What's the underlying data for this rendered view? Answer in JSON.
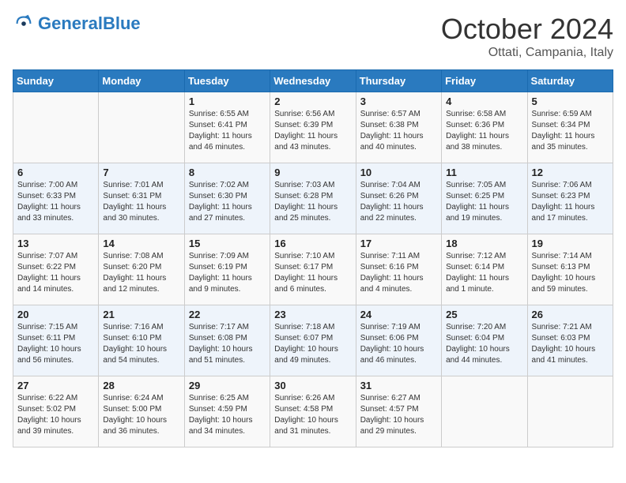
{
  "header": {
    "logo_general": "General",
    "logo_blue": "Blue",
    "month_title": "October 2024",
    "location": "Ottati, Campania, Italy"
  },
  "days_of_week": [
    "Sunday",
    "Monday",
    "Tuesday",
    "Wednesday",
    "Thursday",
    "Friday",
    "Saturday"
  ],
  "weeks": [
    [
      {
        "day": "",
        "info": ""
      },
      {
        "day": "",
        "info": ""
      },
      {
        "day": "1",
        "info": "Sunrise: 6:55 AM\nSunset: 6:41 PM\nDaylight: 11 hours and 46 minutes."
      },
      {
        "day": "2",
        "info": "Sunrise: 6:56 AM\nSunset: 6:39 PM\nDaylight: 11 hours and 43 minutes."
      },
      {
        "day": "3",
        "info": "Sunrise: 6:57 AM\nSunset: 6:38 PM\nDaylight: 11 hours and 40 minutes."
      },
      {
        "day": "4",
        "info": "Sunrise: 6:58 AM\nSunset: 6:36 PM\nDaylight: 11 hours and 38 minutes."
      },
      {
        "day": "5",
        "info": "Sunrise: 6:59 AM\nSunset: 6:34 PM\nDaylight: 11 hours and 35 minutes."
      }
    ],
    [
      {
        "day": "6",
        "info": "Sunrise: 7:00 AM\nSunset: 6:33 PM\nDaylight: 11 hours and 33 minutes."
      },
      {
        "day": "7",
        "info": "Sunrise: 7:01 AM\nSunset: 6:31 PM\nDaylight: 11 hours and 30 minutes."
      },
      {
        "day": "8",
        "info": "Sunrise: 7:02 AM\nSunset: 6:30 PM\nDaylight: 11 hours and 27 minutes."
      },
      {
        "day": "9",
        "info": "Sunrise: 7:03 AM\nSunset: 6:28 PM\nDaylight: 11 hours and 25 minutes."
      },
      {
        "day": "10",
        "info": "Sunrise: 7:04 AM\nSunset: 6:26 PM\nDaylight: 11 hours and 22 minutes."
      },
      {
        "day": "11",
        "info": "Sunrise: 7:05 AM\nSunset: 6:25 PM\nDaylight: 11 hours and 19 minutes."
      },
      {
        "day": "12",
        "info": "Sunrise: 7:06 AM\nSunset: 6:23 PM\nDaylight: 11 hours and 17 minutes."
      }
    ],
    [
      {
        "day": "13",
        "info": "Sunrise: 7:07 AM\nSunset: 6:22 PM\nDaylight: 11 hours and 14 minutes."
      },
      {
        "day": "14",
        "info": "Sunrise: 7:08 AM\nSunset: 6:20 PM\nDaylight: 11 hours and 12 minutes."
      },
      {
        "day": "15",
        "info": "Sunrise: 7:09 AM\nSunset: 6:19 PM\nDaylight: 11 hours and 9 minutes."
      },
      {
        "day": "16",
        "info": "Sunrise: 7:10 AM\nSunset: 6:17 PM\nDaylight: 11 hours and 6 minutes."
      },
      {
        "day": "17",
        "info": "Sunrise: 7:11 AM\nSunset: 6:16 PM\nDaylight: 11 hours and 4 minutes."
      },
      {
        "day": "18",
        "info": "Sunrise: 7:12 AM\nSunset: 6:14 PM\nDaylight: 11 hours and 1 minute."
      },
      {
        "day": "19",
        "info": "Sunrise: 7:14 AM\nSunset: 6:13 PM\nDaylight: 10 hours and 59 minutes."
      }
    ],
    [
      {
        "day": "20",
        "info": "Sunrise: 7:15 AM\nSunset: 6:11 PM\nDaylight: 10 hours and 56 minutes."
      },
      {
        "day": "21",
        "info": "Sunrise: 7:16 AM\nSunset: 6:10 PM\nDaylight: 10 hours and 54 minutes."
      },
      {
        "day": "22",
        "info": "Sunrise: 7:17 AM\nSunset: 6:08 PM\nDaylight: 10 hours and 51 minutes."
      },
      {
        "day": "23",
        "info": "Sunrise: 7:18 AM\nSunset: 6:07 PM\nDaylight: 10 hours and 49 minutes."
      },
      {
        "day": "24",
        "info": "Sunrise: 7:19 AM\nSunset: 6:06 PM\nDaylight: 10 hours and 46 minutes."
      },
      {
        "day": "25",
        "info": "Sunrise: 7:20 AM\nSunset: 6:04 PM\nDaylight: 10 hours and 44 minutes."
      },
      {
        "day": "26",
        "info": "Sunrise: 7:21 AM\nSunset: 6:03 PM\nDaylight: 10 hours and 41 minutes."
      }
    ],
    [
      {
        "day": "27",
        "info": "Sunrise: 6:22 AM\nSunset: 5:02 PM\nDaylight: 10 hours and 39 minutes."
      },
      {
        "day": "28",
        "info": "Sunrise: 6:24 AM\nSunset: 5:00 PM\nDaylight: 10 hours and 36 minutes."
      },
      {
        "day": "29",
        "info": "Sunrise: 6:25 AM\nSunset: 4:59 PM\nDaylight: 10 hours and 34 minutes."
      },
      {
        "day": "30",
        "info": "Sunrise: 6:26 AM\nSunset: 4:58 PM\nDaylight: 10 hours and 31 minutes."
      },
      {
        "day": "31",
        "info": "Sunrise: 6:27 AM\nSunset: 4:57 PM\nDaylight: 10 hours and 29 minutes."
      },
      {
        "day": "",
        "info": ""
      },
      {
        "day": "",
        "info": ""
      }
    ]
  ]
}
